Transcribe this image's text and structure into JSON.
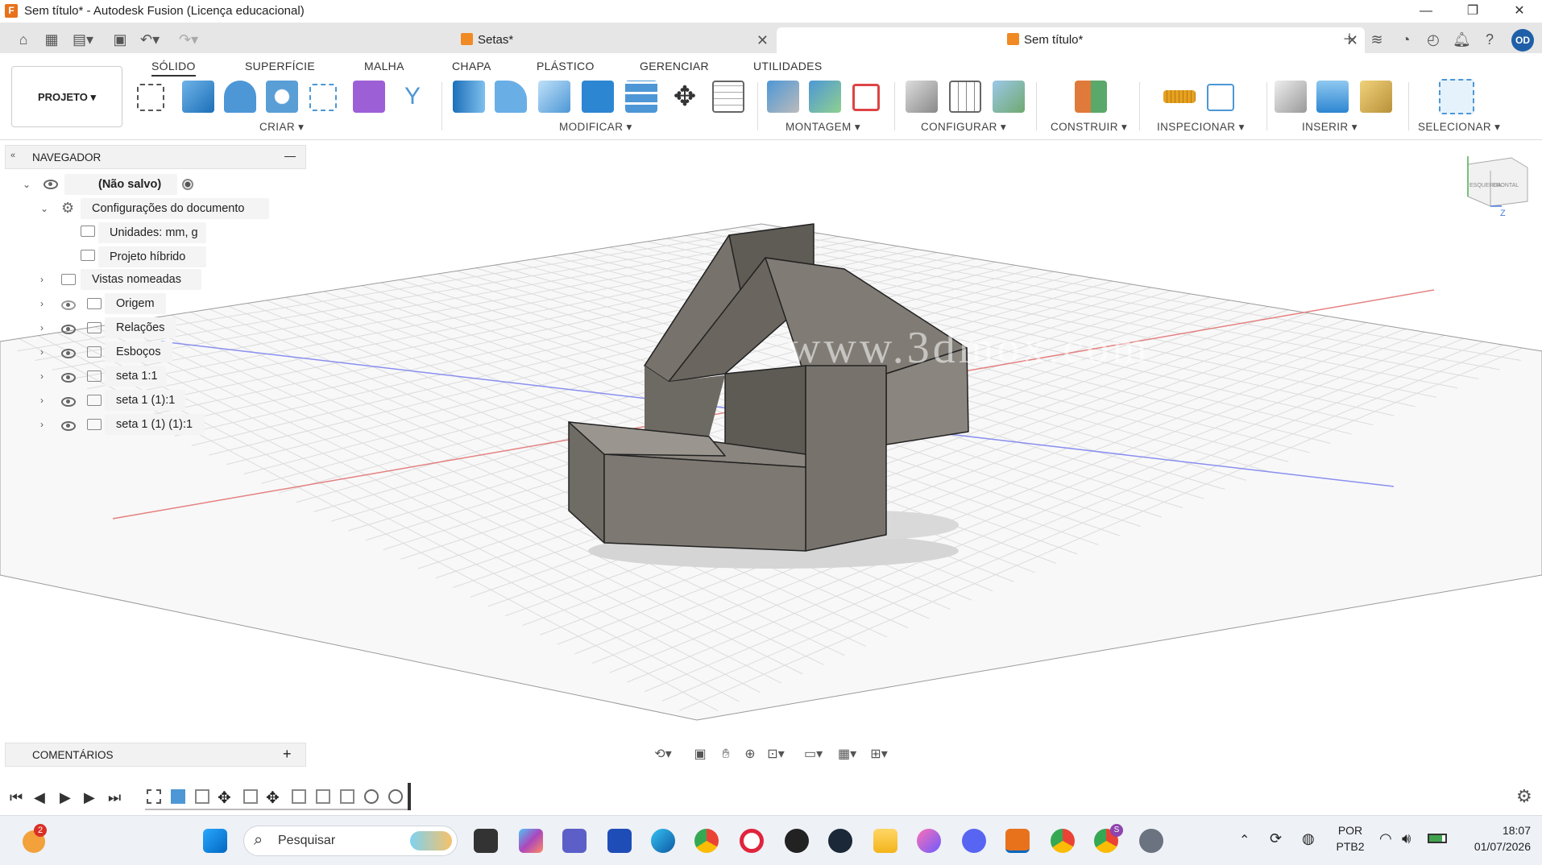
{
  "window": {
    "title": "Sem título* - Autodesk Fusion (Licença educacional)"
  },
  "doc_tabs": [
    {
      "label": "Setas*",
      "active": false
    },
    {
      "label": "Sem título*",
      "active": true
    }
  ],
  "user": {
    "initials": "OD"
  },
  "ribbon": {
    "project_label": "PROJETO",
    "tabs": [
      "SÓLIDO",
      "SUPERFÍCIE",
      "MALHA",
      "CHAPA",
      "PLÁSTICO",
      "GERENCIAR",
      "UTILIDADES"
    ],
    "groups": [
      "CRIAR",
      "MODIFICAR",
      "MONTAGEM",
      "CONFIGURAR",
      "CONSTRUIR",
      "INSPECIONAR",
      "INSERIR",
      "SELECIONAR"
    ]
  },
  "navigator": {
    "title": "NAVEGADOR",
    "root": "(Não salvo)",
    "items": [
      {
        "label": "Configurações do documento"
      },
      {
        "label": "Unidades: mm, g"
      },
      {
        "label": "Projeto híbrido"
      },
      {
        "label": "Vistas nomeadas"
      },
      {
        "label": "Origem"
      },
      {
        "label": "Relações"
      },
      {
        "label": "Esboços"
      },
      {
        "label": "seta 1:1"
      },
      {
        "label": "seta 1 (1):1"
      },
      {
        "label": "seta 1 (1) (1):1"
      }
    ]
  },
  "comments": {
    "title": "COMENTÁRIOS"
  },
  "viewcube": {
    "left": "ESQUERDA",
    "front": "FRONTAL",
    "axis": "Z"
  },
  "watermark": "www.3dmox.com",
  "taskbar": {
    "search_placeholder": "Pesquisar",
    "notification_badge": "2",
    "lang_top": "POR",
    "lang_bottom": "PTB2",
    "time": "18:07",
    "date": "01/07/2026",
    "chrome_badge": "S"
  },
  "colors": {
    "accent": "#0696d7",
    "model": "#6e6a63",
    "axis_red": "#e05050",
    "axis_blue": "#5a62d8",
    "fusion_orange": "#f08a24"
  }
}
